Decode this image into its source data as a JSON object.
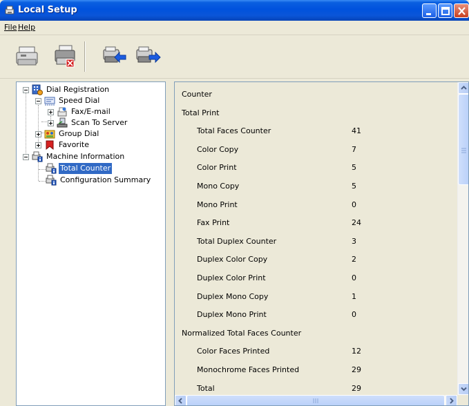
{
  "window": {
    "title": "Local Setup",
    "colors": {
      "titlebar": "#0052dd",
      "selection": "#316ac5",
      "close": "#c9401f"
    }
  },
  "menu": {
    "file": "File",
    "help": "Help"
  },
  "toolbar": {
    "icons": [
      "printer-icon",
      "printer-delete-icon",
      "printer-import-icon",
      "printer-export-icon"
    ]
  },
  "tree": {
    "dial_registration": "Dial Registration",
    "speed_dial": "Speed Dial",
    "fax_email": "Fax/E-mail",
    "scan_to_server": "Scan To Server",
    "group_dial": "Group Dial",
    "favorite": "Favorite",
    "machine_information": "Machine Information",
    "total_counter": "Total Counter",
    "configuration_summary": "Configuration Summary",
    "selected": "Total Counter"
  },
  "counter": {
    "rows": [
      {
        "type": "section",
        "name": "Counter",
        "value": ""
      },
      {
        "type": "section",
        "name": "Total Print",
        "value": ""
      },
      {
        "type": "item",
        "name": "Total Faces Counter",
        "value": "41"
      },
      {
        "type": "item",
        "name": "Color Copy",
        "value": "7"
      },
      {
        "type": "item",
        "name": "Color Print",
        "value": "5"
      },
      {
        "type": "item",
        "name": "Mono Copy",
        "value": "5"
      },
      {
        "type": "item",
        "name": "Mono Print",
        "value": "0"
      },
      {
        "type": "item",
        "name": "Fax Print",
        "value": "24"
      },
      {
        "type": "item",
        "name": "Total Duplex Counter",
        "value": "3"
      },
      {
        "type": "item",
        "name": "Duplex Color Copy",
        "value": "2"
      },
      {
        "type": "item",
        "name": "Duplex Color Print",
        "value": "0"
      },
      {
        "type": "item",
        "name": "Duplex Mono Copy",
        "value": "1"
      },
      {
        "type": "item",
        "name": "Duplex Mono Print",
        "value": "0"
      },
      {
        "type": "section",
        "name": "Normalized Total Faces Counter",
        "value": ""
      },
      {
        "type": "item",
        "name": "Color Faces Printed",
        "value": "12"
      },
      {
        "type": "item",
        "name": "Monochrome Faces Printed",
        "value": "29"
      },
      {
        "type": "item",
        "name": "Total",
        "value": "29"
      }
    ]
  }
}
